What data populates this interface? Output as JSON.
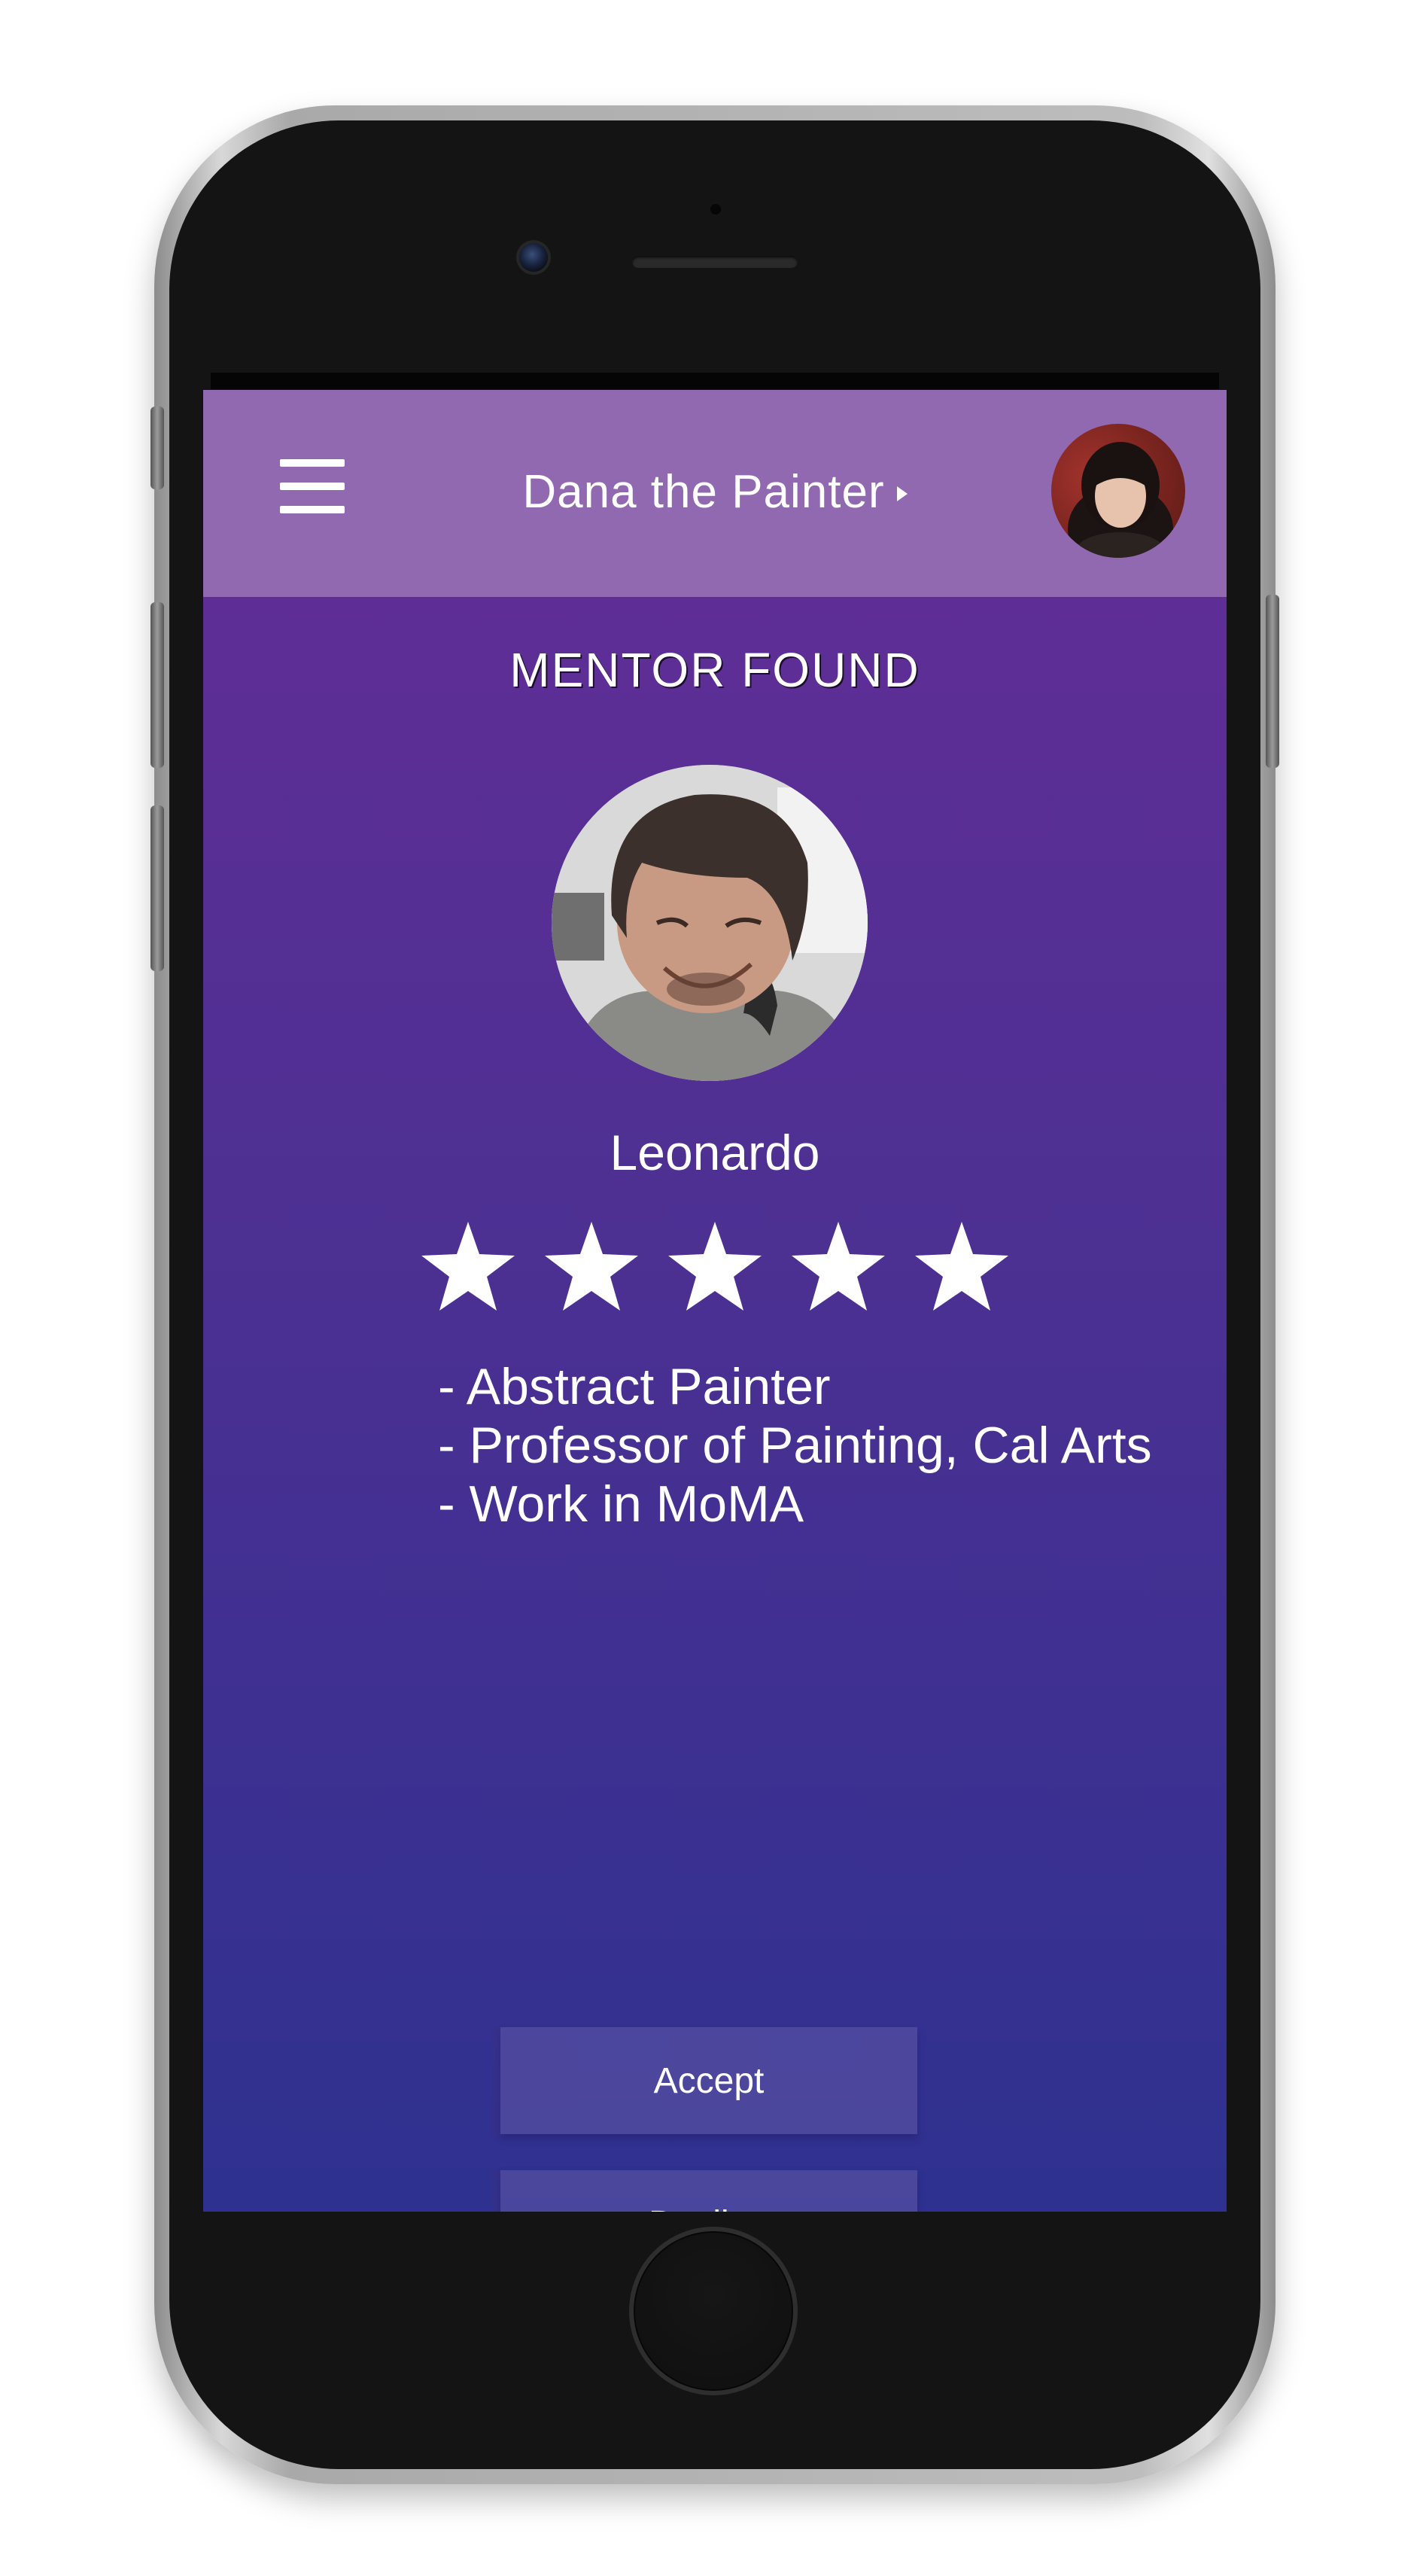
{
  "header": {
    "title": "Dana the Painter",
    "menu_icon": "hamburger-menu-icon",
    "caret_icon": "caret-right-icon",
    "background_color": "#9169b0"
  },
  "screen": {
    "heading": "MENTOR FOUND",
    "gradient_top": "#5e2e96",
    "gradient_bottom": "#2e3190"
  },
  "mentor": {
    "name": "Leonardo",
    "rating": 5,
    "rating_max": 5,
    "bio": [
      "- Abstract Painter",
      "- Professor of Painting, Cal Arts",
      "- Work in MoMA"
    ]
  },
  "actions": {
    "accept_label": "Accept",
    "decline_label": "Decline"
  }
}
